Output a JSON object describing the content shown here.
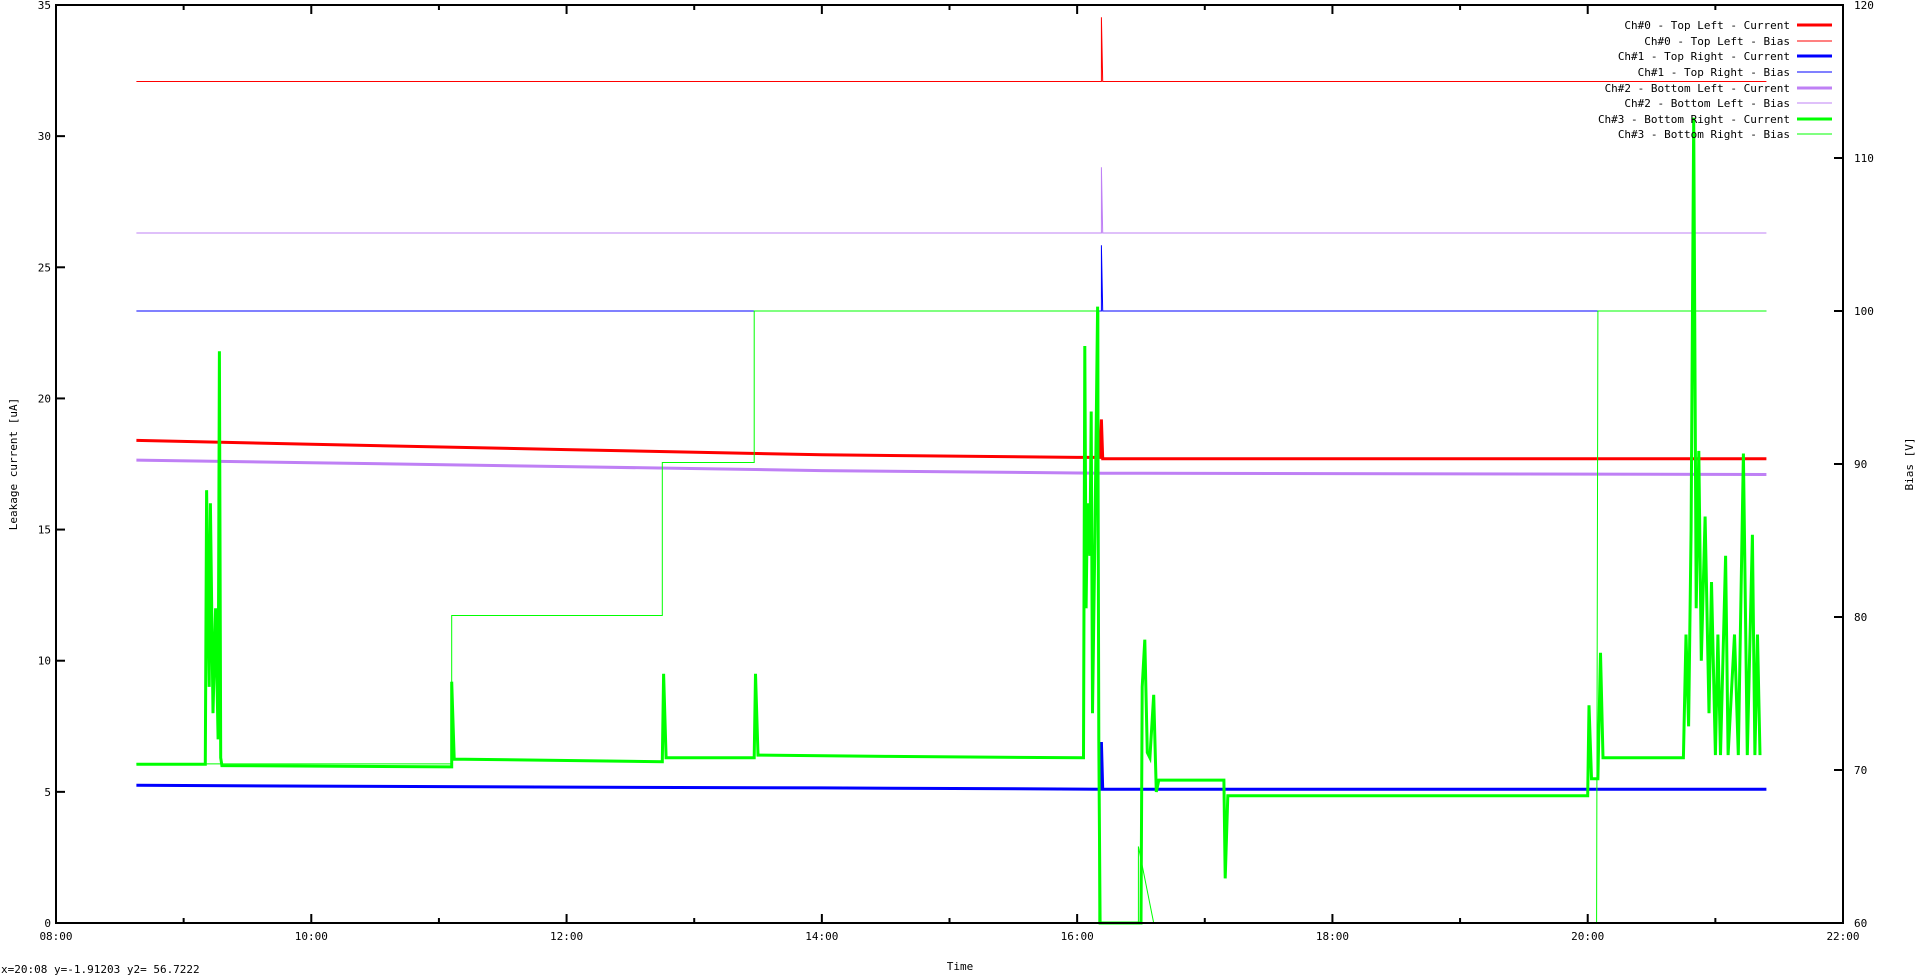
{
  "chart_data": {
    "type": "line",
    "title": "",
    "xlabel": "Time",
    "ylabel": "Leakage current [uA]",
    "y2label": "Bias [V]",
    "xlim_hours": [
      8,
      22
    ],
    "ylim": [
      0,
      35
    ],
    "y2lim": [
      60,
      120
    ],
    "x_ticks": [
      "08:00",
      "10:00",
      "12:00",
      "14:00",
      "16:00",
      "18:00",
      "20:00",
      "22:00"
    ],
    "y_ticks": [
      0,
      5,
      10,
      15,
      20,
      25,
      30,
      35
    ],
    "y2_ticks": [
      60,
      70,
      80,
      90,
      100,
      110,
      120
    ],
    "grid": false,
    "legend_position": "top-right",
    "series": [
      {
        "name": "Ch#0 - Top Left - Current",
        "axis": "y",
        "color": "#ff0000",
        "weight": "thick",
        "points": [
          [
            8.63,
            18.4
          ],
          [
            10,
            18.25
          ],
          [
            12,
            18.05
          ],
          [
            14,
            17.85
          ],
          [
            16,
            17.75
          ],
          [
            16.18,
            17.75
          ],
          [
            16.19,
            19.2
          ],
          [
            16.2,
            17.7
          ],
          [
            21.4,
            17.7
          ]
        ]
      },
      {
        "name": "Ch#0 - Top Left - Bias",
        "axis": "y2",
        "color": "#ff0000",
        "weight": "thin",
        "points": [
          [
            8.63,
            115
          ],
          [
            16.19,
            115
          ],
          [
            16.19,
            119.2
          ],
          [
            16.2,
            115
          ],
          [
            21.4,
            115
          ]
        ]
      },
      {
        "name": "Ch#1 - Top Right - Current",
        "axis": "y",
        "color": "#0000ff",
        "weight": "thick",
        "points": [
          [
            8.63,
            5.25
          ],
          [
            10,
            5.22
          ],
          [
            12,
            5.18
          ],
          [
            14,
            5.15
          ],
          [
            16.19,
            5.1
          ],
          [
            16.19,
            6.9
          ],
          [
            16.2,
            5.1
          ],
          [
            21.4,
            5.1
          ]
        ]
      },
      {
        "name": "Ch#1 - Top Right - Bias",
        "axis": "y2",
        "color": "#0000ff",
        "weight": "thin",
        "points": [
          [
            8.63,
            100
          ],
          [
            16.19,
            100
          ],
          [
            16.19,
            104.3
          ],
          [
            16.2,
            100
          ],
          [
            21.4,
            100
          ]
        ]
      },
      {
        "name": "Ch#2 - Bottom Left - Current",
        "axis": "y",
        "color": "#bf80f5",
        "weight": "thick",
        "points": [
          [
            8.63,
            17.65
          ],
          [
            10,
            17.55
          ],
          [
            12,
            17.4
          ],
          [
            14,
            17.25
          ],
          [
            16.2,
            17.15
          ],
          [
            21.4,
            17.1
          ]
        ]
      },
      {
        "name": "Ch#2 - Bottom Left - Bias",
        "axis": "y2",
        "color": "#bf80f5",
        "weight": "thin",
        "points": [
          [
            8.63,
            105.1
          ],
          [
            16.19,
            105.1
          ],
          [
            16.19,
            109.4
          ],
          [
            16.2,
            105.1
          ],
          [
            21.4,
            105.1
          ]
        ]
      },
      {
        "name": "Ch#3 - Bottom Right - Current",
        "axis": "y",
        "color": "#00ff00",
        "weight": "thick",
        "points": [
          [
            8.63,
            6.05
          ],
          [
            9.17,
            6.05
          ],
          [
            9.18,
            16.5
          ],
          [
            9.2,
            9
          ],
          [
            9.21,
            16
          ],
          [
            9.23,
            8
          ],
          [
            9.25,
            12
          ],
          [
            9.27,
            7
          ],
          [
            9.28,
            21.8
          ],
          [
            9.29,
            6.3
          ],
          [
            9.3,
            6.0
          ],
          [
            11.1,
            5.95
          ],
          [
            11.1,
            9.2
          ],
          [
            11.12,
            6.25
          ],
          [
            12.75,
            6.15
          ],
          [
            12.76,
            9.5
          ],
          [
            12.78,
            6.3
          ],
          [
            13.47,
            6.3
          ],
          [
            13.48,
            9.5
          ],
          [
            13.5,
            6.4
          ],
          [
            14.5,
            6.35
          ],
          [
            16.05,
            6.3
          ],
          [
            16.06,
            22
          ],
          [
            16.07,
            12
          ],
          [
            16.08,
            16
          ],
          [
            16.1,
            14
          ],
          [
            16.11,
            19.5
          ],
          [
            16.12,
            8
          ],
          [
            16.14,
            15
          ],
          [
            16.16,
            23.5
          ],
          [
            16.17,
            7
          ],
          [
            16.18,
            0
          ],
          [
            16.5,
            0
          ],
          [
            16.51,
            9
          ],
          [
            16.53,
            10.8
          ],
          [
            16.55,
            6.5
          ],
          [
            16.57,
            6.3
          ],
          [
            16.6,
            8.7
          ],
          [
            16.62,
            5
          ],
          [
            16.64,
            5.45
          ],
          [
            17.15,
            5.45
          ],
          [
            17.16,
            1.7
          ],
          [
            17.18,
            4.85
          ],
          [
            20.0,
            4.85
          ],
          [
            20.01,
            8.3
          ],
          [
            20.03,
            5.5
          ],
          [
            20.08,
            5.5
          ],
          [
            20.1,
            10.3
          ],
          [
            20.12,
            6.3
          ],
          [
            20.75,
            6.3
          ],
          [
            20.77,
            11
          ],
          [
            20.79,
            7.5
          ],
          [
            20.81,
            15
          ],
          [
            20.83,
            30.7
          ],
          [
            20.85,
            12
          ],
          [
            20.87,
            18
          ],
          [
            20.89,
            10
          ],
          [
            20.92,
            15.5
          ],
          [
            20.95,
            8
          ],
          [
            20.97,
            13
          ],
          [
            21.0,
            6.4
          ],
          [
            21.02,
            11
          ],
          [
            21.04,
            6.4
          ],
          [
            21.08,
            14
          ],
          [
            21.1,
            6.4
          ],
          [
            21.15,
            11
          ],
          [
            21.18,
            6.4
          ],
          [
            21.22,
            17.9
          ],
          [
            21.25,
            6.4
          ],
          [
            21.29,
            14.8
          ],
          [
            21.31,
            6.4
          ],
          [
            21.33,
            11
          ],
          [
            21.35,
            6.4
          ]
        ]
      },
      {
        "name": "Ch#3 - Bottom Right - Bias",
        "axis": "y2",
        "color": "#00ff00",
        "weight": "thin",
        "points": [
          [
            8.63,
            70.4
          ],
          [
            11.1,
            70.4
          ],
          [
            11.1,
            80.1
          ],
          [
            12.75,
            80.1
          ],
          [
            12.75,
            90.1
          ],
          [
            13.47,
            90.1
          ],
          [
            13.47,
            100
          ],
          [
            16.17,
            100
          ],
          [
            16.17,
            60
          ],
          [
            16.48,
            60
          ],
          [
            16.48,
            65
          ],
          [
            16.6,
            60
          ],
          [
            20.07,
            60
          ],
          [
            20.08,
            100
          ],
          [
            21.4,
            100
          ]
        ]
      }
    ]
  },
  "status_bar": {
    "text": "x=20:08 y=-1.91203 y2= 56.7222"
  }
}
